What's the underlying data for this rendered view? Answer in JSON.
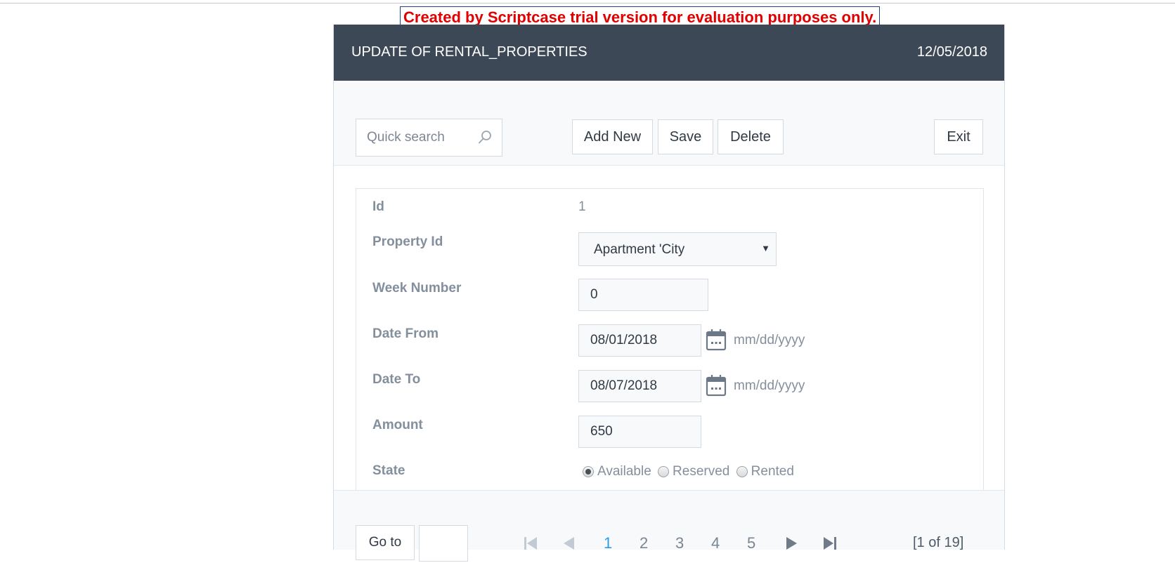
{
  "trial_banner": "Created by Scriptcase trial version for evaluation purposes only.",
  "header": {
    "title": "UPDATE OF RENTAL_PROPERTIES",
    "date": "12/05/2018"
  },
  "toolbar": {
    "search_placeholder": "Quick search",
    "add_new_label": "Add New",
    "save_label": "Save",
    "delete_label": "Delete",
    "exit_label": "Exit"
  },
  "form": {
    "id": {
      "label": "Id",
      "value": "1"
    },
    "property_id": {
      "label": "Property Id",
      "value": "Apartment 'City"
    },
    "week_number": {
      "label": "Week Number",
      "value": "0"
    },
    "date_from": {
      "label": "Date From",
      "value": "08/01/2018",
      "format_hint": "mm/dd/yyyy"
    },
    "date_to": {
      "label": "Date To",
      "value": "08/07/2018",
      "format_hint": "mm/dd/yyyy"
    },
    "amount": {
      "label": "Amount",
      "value": "650"
    },
    "state": {
      "label": "State",
      "options": [
        "Available",
        "Reserved",
        "Rented"
      ],
      "selected": "Available"
    }
  },
  "pagination": {
    "goto_label": "Go to",
    "goto_value": "",
    "pages": [
      "1",
      "2",
      "3",
      "4",
      "5"
    ],
    "current_page": "1",
    "record_count": "[1 of 19]"
  },
  "colors": {
    "header_bg": "#3d4856",
    "banner_text": "#e00000",
    "active_page": "#2e9de6",
    "label_text": "#848f9d"
  },
  "icons": {
    "search": "search-icon",
    "calendar": "calendar-icon",
    "first": "first-page-icon",
    "prev": "previous-page-icon",
    "next": "next-page-icon",
    "last": "last-page-icon"
  }
}
